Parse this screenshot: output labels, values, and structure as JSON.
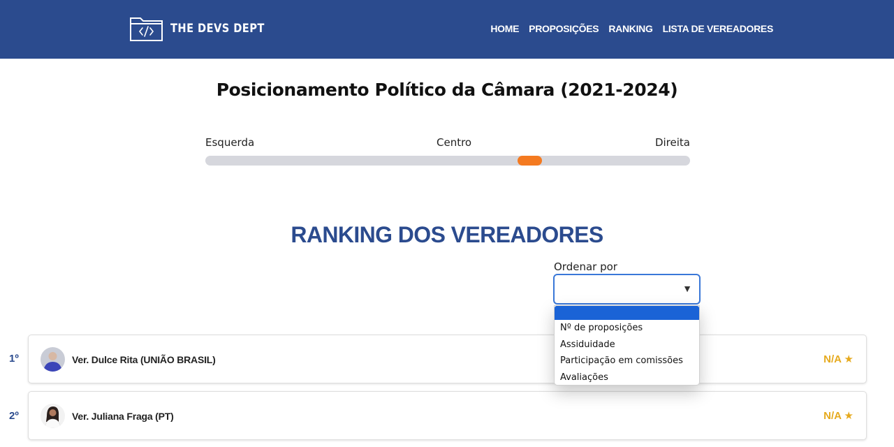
{
  "header": {
    "brand": "THE DEVS DEPT",
    "nav": [
      "HOME",
      "PROPOSIÇÕES",
      "RANKING",
      "LISTA DE VEREADORES"
    ]
  },
  "position": {
    "title": "Posicionamento Político da Câmara (2021-2024)",
    "left_label": "Esquerda",
    "center_label": "Centro",
    "right_label": "Direita",
    "marker_fraction": 0.67,
    "marker_color": "#f47a20"
  },
  "ranking": {
    "title": "RANKING DOS VEREADORES",
    "sort_label": "Ordenar por",
    "sort_value": "",
    "sort_options": [
      "",
      "Nº de proposições",
      "Assiduidade",
      "Participação em comissões",
      "Avaliações"
    ],
    "rows": [
      {
        "rank": "1º",
        "name": "Ver. Dulce Rita (UNIÃO BRASIL)",
        "score": "N/A ★"
      },
      {
        "rank": "2º",
        "name": "Ver. Juliana Fraga (PT)",
        "score": "N/A ★"
      }
    ]
  },
  "colors": {
    "brand": "#2b4b8e",
    "accent": "#f47a20",
    "score": "#e6aa1e",
    "select_highlight": "#1a63d6"
  },
  "icons": {
    "brand": "folder-code-icon",
    "sort": "caret-down-icon",
    "star": "star-icon"
  }
}
